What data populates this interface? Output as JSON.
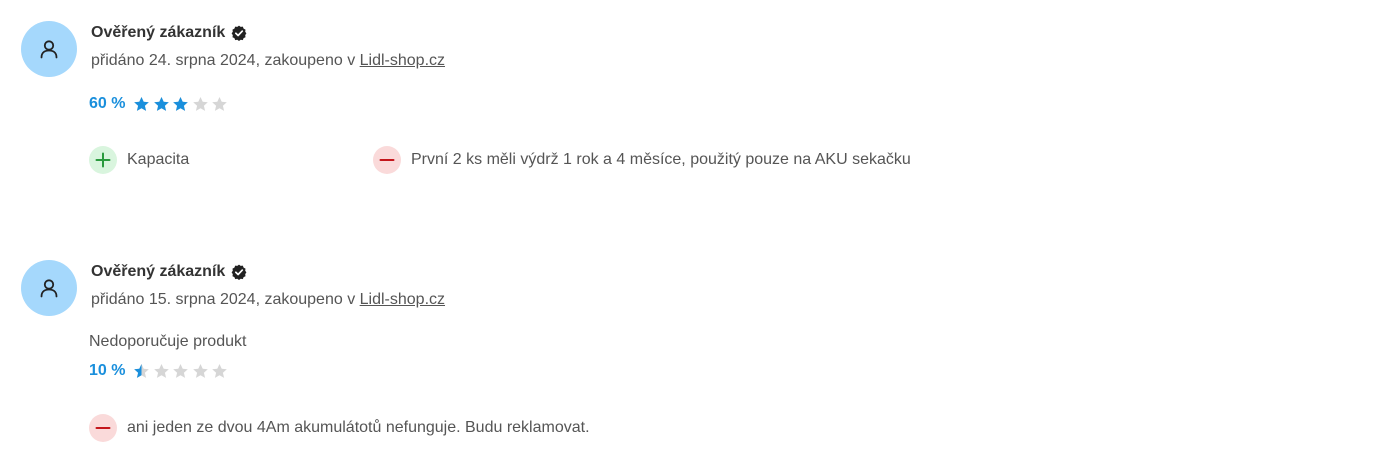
{
  "colors": {
    "avatar_bg": "#a5d8fc",
    "rating_blue": "#1a8fdc",
    "star_empty": "#d6d6d6",
    "plus_bg": "#d9f5de",
    "plus_fg": "#2a9a3e",
    "minus_bg": "#fadada",
    "minus_fg": "#c4161c"
  },
  "reviews": [
    {
      "author": "Ověřený zákazník",
      "meta_prefix": "přidáno 24. srpna 2024, zakoupeno v ",
      "shop_link": "Lidl-shop.cz",
      "recommend": "",
      "rating_label": "60 %",
      "rating_fraction": 0.6,
      "pros": [
        "Kapacita"
      ],
      "cons": [
        "První 2 ks měli výdrž 1 rok a 4 měsíce, použitý pouze na AKU sekačku"
      ]
    },
    {
      "author": "Ověřený zákazník",
      "meta_prefix": "přidáno 15. srpna 2024, zakoupeno v ",
      "shop_link": "Lidl-shop.cz",
      "recommend": "Nedoporučuje produkt",
      "rating_label": "10 %",
      "rating_fraction": 0.1,
      "pros": [],
      "cons": [
        "ani jeden ze dvou 4Am akumulátotů nefunguje. Budu reklamovat."
      ]
    }
  ]
}
